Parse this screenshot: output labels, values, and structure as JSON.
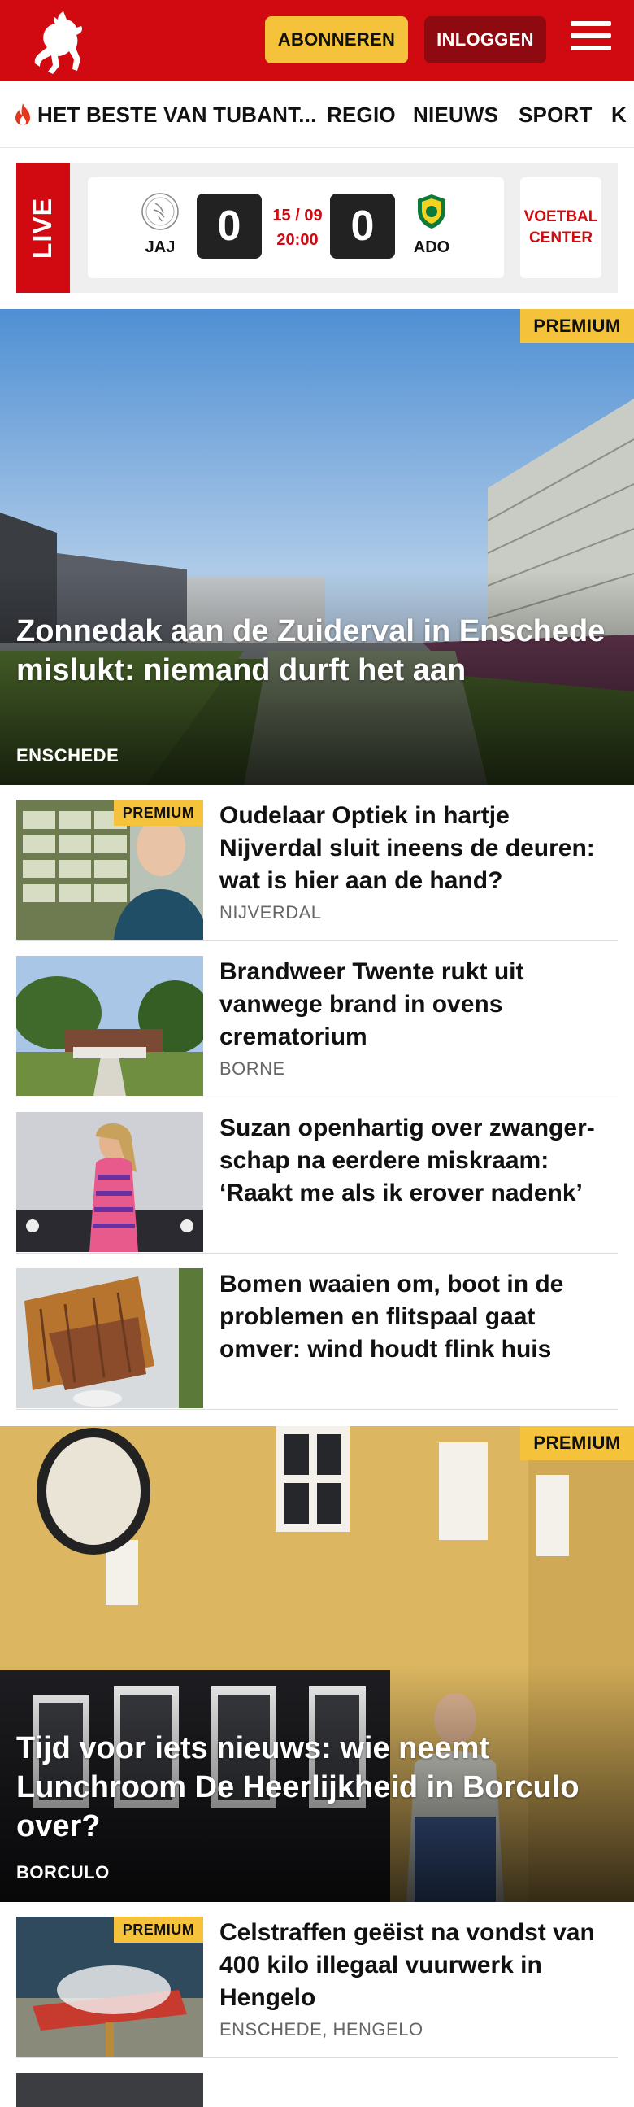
{
  "header": {
    "subscribe_label": "ABONNEREN",
    "login_label": "INLOGGEN",
    "brand_color": "#d10a11",
    "menu_icon": "hamburger-icon"
  },
  "nav": {
    "items": [
      {
        "label": "HET BESTE VAN TUBANT...",
        "icon": "flame-icon"
      },
      {
        "label": "REGIO"
      },
      {
        "label": "NIEUWS"
      },
      {
        "label": "SPORT"
      },
      {
        "label": "K"
      }
    ]
  },
  "live": {
    "label": "LIVE",
    "match": {
      "home": "JAJ",
      "away": "ADO",
      "home_score": "0",
      "away_score": "0",
      "date": "15 / 09",
      "time": "20:00"
    },
    "voetbal_center": "VOETBAL CENTER"
  },
  "articles": [
    {
      "premium": true,
      "premium_label": "PREMIUM",
      "title": "Zonnedak aan de Zuiderval in Enschede mislukt: niemand durft het aan",
      "location": "ENSCHEDE",
      "featured": true
    },
    {
      "premium": true,
      "premium_label": "PREMIUM",
      "title": "Oudelaar Optiek in hartje Nijverdal sluit ineens de deuren: wat is hier aan de hand?",
      "location": "NIJVERDAL"
    },
    {
      "premium": false,
      "title": "Brandweer Twente rukt uit vanwege brand in ovens crematorium",
      "location": "BORNE"
    },
    {
      "premium": false,
      "title": "Suzan openhartig over zwanger­schap na eerdere miskraam: ‘Raakt me als ik erover nadenk’",
      "location": ""
    },
    {
      "premium": false,
      "title": "Bomen waaien om, boot in de problemen en flitspaal gaat omver: wind houdt flink huis",
      "location": ""
    },
    {
      "premium": true,
      "premium_label": "PREMIUM",
      "title": "Tijd voor iets nieuws: wie neemt Lunchroom De Heerlijkheid in Borculo over?",
      "location": "BORCULO",
      "featured": true
    },
    {
      "premium": true,
      "premium_label": "PREMIUM",
      "title": "Celstraffen geëist na vondst van 400 kilo illegaal vuurwerk in Hengelo",
      "location": "ENSCHEDE, HENGELO"
    }
  ]
}
